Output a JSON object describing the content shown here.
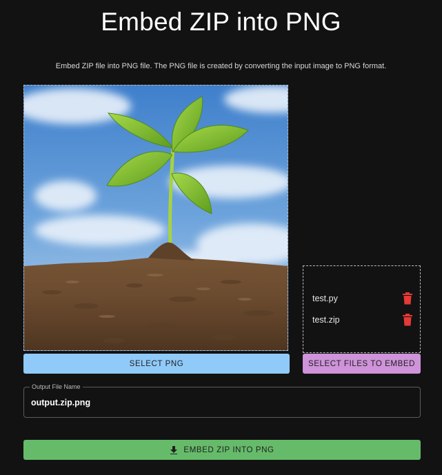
{
  "header": {
    "title": "Embed ZIP into PNG",
    "subtitle": "Embed ZIP file into PNG file. The PNG file is created by converting the input image to PNG format."
  },
  "image_panel": {
    "select_png_label": "SELECT PNG"
  },
  "files_panel": {
    "files": [
      {
        "name": "test.py",
        "icon": "trash-icon"
      },
      {
        "name": "test.zip",
        "icon": "trash-icon"
      }
    ],
    "select_files_label": "SELECT FILES TO EMBED"
  },
  "output_field": {
    "label": "Output File Name",
    "value": "output.zip.png"
  },
  "actions": {
    "embed_label": "EMBED ZIP INTO PNG",
    "embed_icon": "download-icon"
  },
  "colors": {
    "background": "#121212",
    "select_png_button": "#90caf9",
    "select_files_button": "#ce93d8",
    "embed_button": "#66bb6a",
    "delete_icon": "#e53935"
  }
}
